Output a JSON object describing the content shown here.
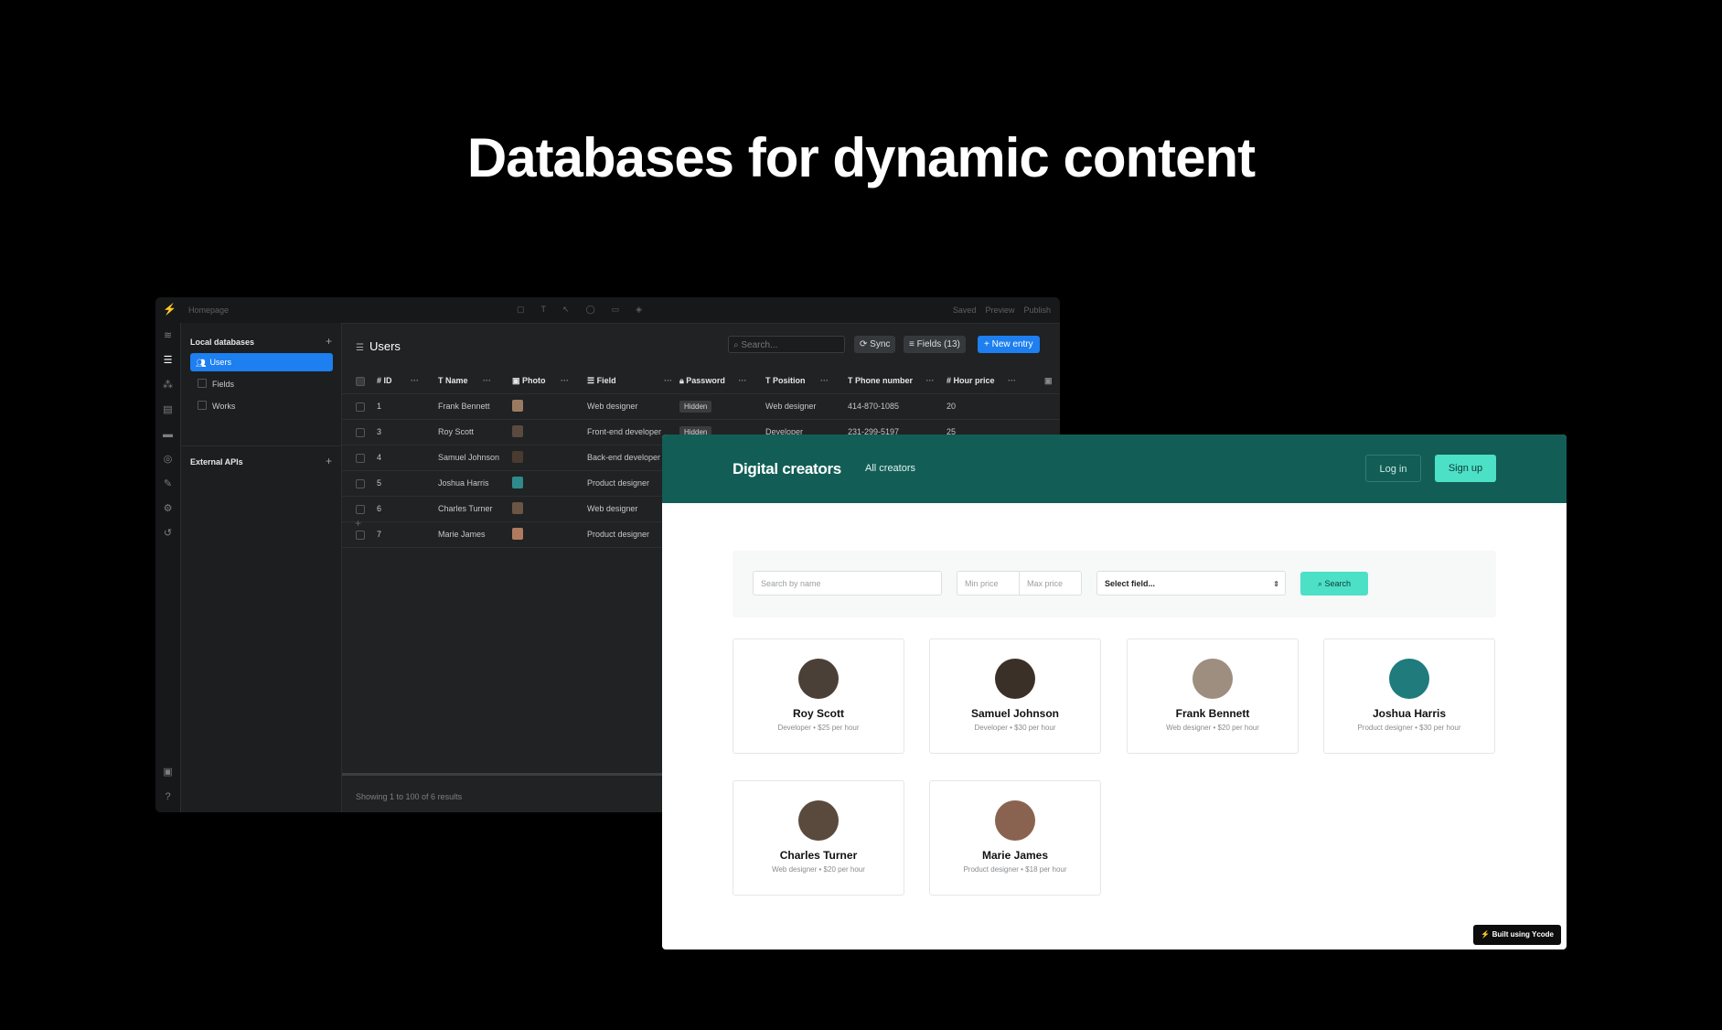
{
  "headline": "Databases for dynamic content",
  "editor": {
    "page_name": "Homepage",
    "toolbar_right": [
      "Saved",
      "Preview",
      "Publish"
    ],
    "sidebar": {
      "local_heading": "Local databases",
      "items": [
        {
          "label": "Users",
          "selected": true
        },
        {
          "label": "Fields",
          "selected": false
        },
        {
          "label": "Works",
          "selected": false
        }
      ],
      "external_heading": "External APIs"
    },
    "main": {
      "title": "Users",
      "search_placeholder": "Search...",
      "sync_label": "Sync",
      "fields_label": "Fields (13)",
      "new_entry_label": "New entry",
      "columns": [
        "ID",
        "Name",
        "Photo",
        "Field",
        "Password",
        "Position",
        "Phone number",
        "Hour price"
      ],
      "rows": [
        {
          "id": "1",
          "name": "Frank Bennett",
          "field": "Web designer",
          "password": "Hidden",
          "position": "Web designer",
          "phone": "414-870-1085",
          "price": "20",
          "photo": "#9a7b62"
        },
        {
          "id": "3",
          "name": "Roy Scott",
          "field": "Front-end developer",
          "password": "Hidden",
          "position": "Developer",
          "phone": "231-299-5197",
          "price": "25",
          "photo": "#5a4a40"
        },
        {
          "id": "4",
          "name": "Samuel Johnson",
          "field": "Back-end developer",
          "password": "",
          "position": "",
          "phone": "",
          "price": "",
          "photo": "#4a3b30"
        },
        {
          "id": "5",
          "name": "Joshua Harris",
          "field": "Product designer",
          "password": "",
          "position": "",
          "phone": "",
          "price": "",
          "photo": "#2f8a8c"
        },
        {
          "id": "6",
          "name": "Charles Turner",
          "field": "Web designer",
          "password": "",
          "position": "",
          "phone": "",
          "price": "",
          "photo": "#6b5545"
        },
        {
          "id": "7",
          "name": "Marie James",
          "field": "Product designer",
          "password": "",
          "position": "",
          "phone": "",
          "price": "",
          "photo": "#b07a5e"
        }
      ],
      "footer": "Showing 1 to 100 of 6 results"
    }
  },
  "site": {
    "brand": "Digital creators",
    "nav_link": "All creators",
    "login_label": "Log in",
    "signup_label": "Sign up",
    "filters": {
      "name_placeholder": "Search by name",
      "min_placeholder": "Min price",
      "max_placeholder": "Max price",
      "select_value": "Select field...",
      "search_label": "Search"
    },
    "creators": [
      {
        "name": "Roy Scott",
        "meta": "Developer • $25 per hour",
        "avatar": "#4b4038"
      },
      {
        "name": "Samuel Johnson",
        "meta": "Developer • $30 per hour",
        "avatar": "#3b3027"
      },
      {
        "name": "Frank Bennett",
        "meta": "Web designer • $20 per hour",
        "avatar": "#9d8e80"
      },
      {
        "name": "Joshua Harris",
        "meta": "Product designer • $30 per hour",
        "avatar": "#1f7b7c"
      },
      {
        "name": "Charles Turner",
        "meta": "Web designer • $20 per hour",
        "avatar": "#5a4a3d"
      },
      {
        "name": "Marie James",
        "meta": "Product designer • $18 per hour",
        "avatar": "#8a6350"
      }
    ],
    "badge": "Built using Ycode"
  }
}
